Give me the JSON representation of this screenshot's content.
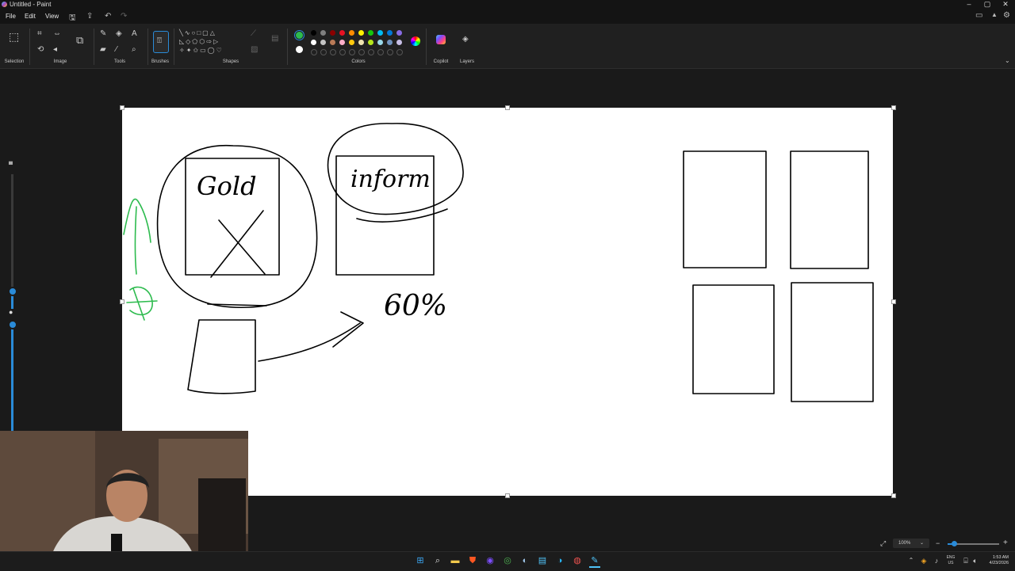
{
  "window": {
    "title": "Untitled - Paint",
    "minimize": "–",
    "maximize": "▢",
    "close": "✕"
  },
  "menu": {
    "file": "File",
    "edit": "Edit",
    "view": "View"
  },
  "ribbon": {
    "groups": {
      "selection": "Selection",
      "image": "Image",
      "tools": "Tools",
      "brushes": "Brushes",
      "shapes": "Shapes",
      "colors": "Colors",
      "copilot": "Copilot",
      "layers": "Layers"
    },
    "tools_text_icon": "A",
    "selected_color": "#2dbb4e",
    "secondary_color": "#ffffff",
    "palette_row1": [
      "#000000",
      "#7f7f7f",
      "#8b0000",
      "#e81123",
      "#ff8c00",
      "#fff100",
      "#16c60c",
      "#00bcf2",
      "#0078d7",
      "#886ce4"
    ],
    "palette_row2": [
      "#ffffff",
      "#c3c3c3",
      "#b97a57",
      "#ffaec9",
      "#ffc90e",
      "#efe4b0",
      "#b5e61d",
      "#99d9ea",
      "#7092be",
      "#c8bfe7"
    ]
  },
  "canvas": {
    "strokes": {
      "gold": "Gold",
      "inform": "inform",
      "percent": "60%"
    }
  },
  "status": {
    "zoom": "100%",
    "zoom_minus": "−",
    "zoom_plus": "+"
  },
  "system_tray": {
    "lang1": "ENG",
    "lang2": "US",
    "time": "1:53 AM",
    "date": "4/23/2026"
  }
}
